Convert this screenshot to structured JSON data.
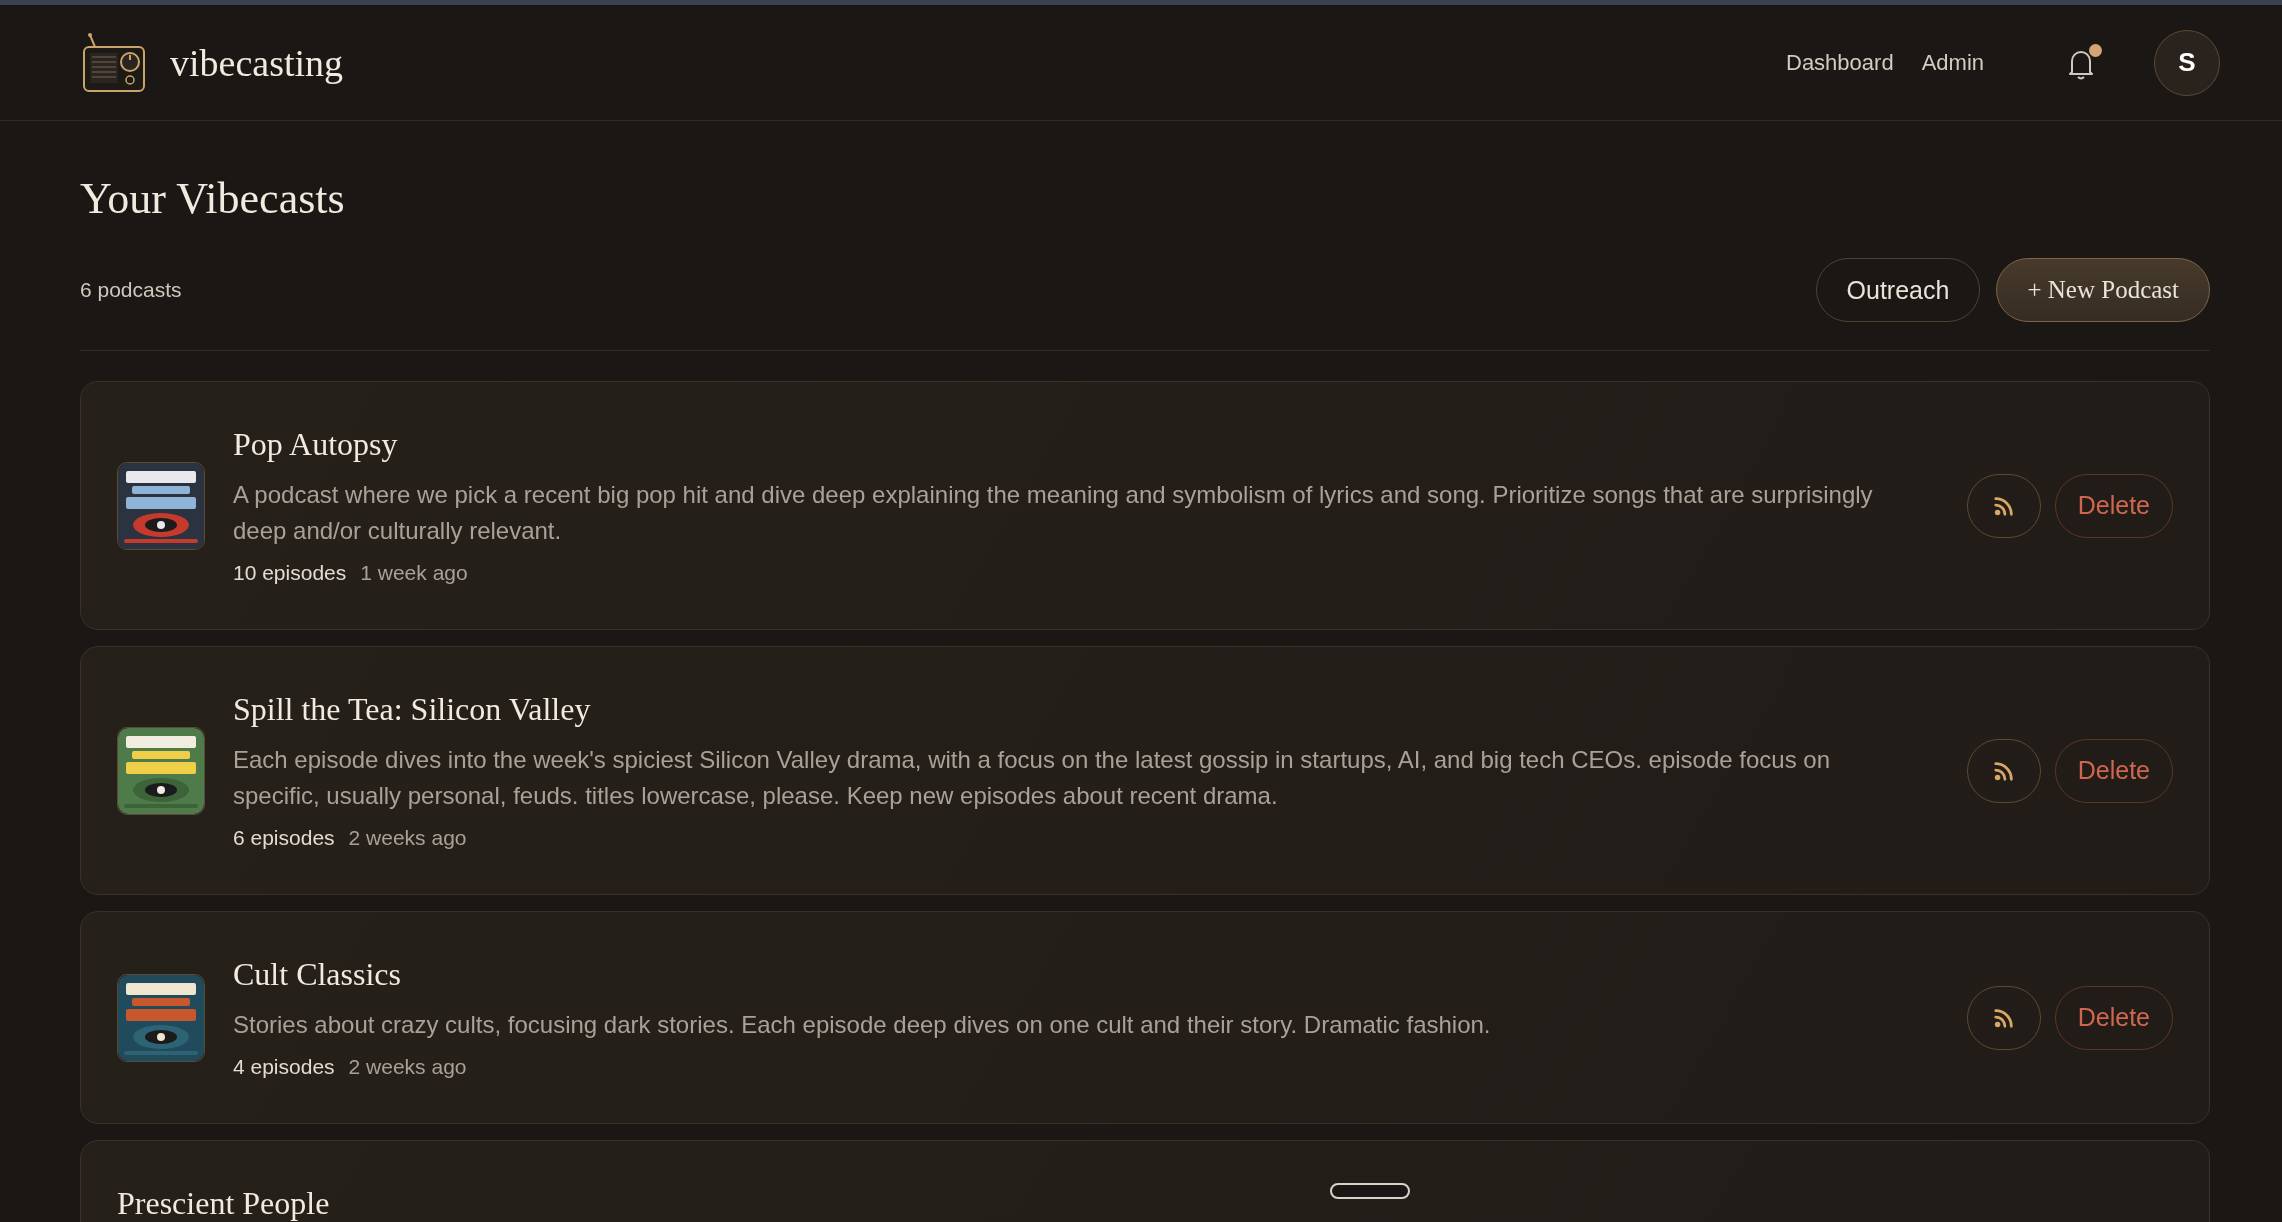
{
  "header": {
    "brand": "vibecasting",
    "nav": [
      "Dashboard",
      "Admin"
    ],
    "notifications": {
      "unread": true
    },
    "avatar": "S"
  },
  "page": {
    "title": "Your Vibecasts",
    "count": "6 podcasts",
    "actions": [
      {
        "label": "Outreach",
        "kind": "secondary"
      },
      {
        "label": "+ New Podcast",
        "kind": "primary"
      }
    ]
  },
  "podcasts": [
    {
      "title": "Pop Autopsy",
      "description": "A podcast where we pick a recent big pop hit and dive deep explaining the meaning and symbolism of lyrics and song. Prioritize songs that are surprisingly deep and/or culturally relevant.",
      "episodes": "10 episodes",
      "updated": "1 week ago",
      "delete": "Delete"
    },
    {
      "title": "Spill the Tea: Silicon Valley",
      "description": "Each episode dives into the week's spiciest Silicon Valley drama, with a focus on the latest gossip in startups, AI, and big tech CEOs. episode focus on specific, usually personal, feuds. titles lowercase, please. Keep new episodes about recent drama.",
      "episodes": "6 episodes",
      "updated": "2 weeks ago",
      "delete": "Delete"
    },
    {
      "title": "Cult Classics",
      "description": "Stories about crazy cults, focusing dark stories. Each episode deep dives on one cult and their story. Dramatic fashion.",
      "episodes": "4 episodes",
      "updated": "2 weeks ago",
      "delete": "Delete"
    },
    {
      "title": "Prescient People"
    }
  ]
}
